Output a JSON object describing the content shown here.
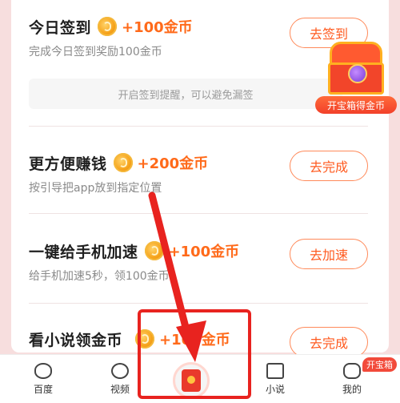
{
  "tasks": [
    {
      "title": "今日签到",
      "reward": "+100金币",
      "desc": "完成今日签到奖励100金币",
      "button": "去签到"
    },
    {
      "title": "更方便赚钱",
      "reward": "+200金币",
      "desc": "按引导把app放到指定位置",
      "button": "去完成"
    },
    {
      "title": "一键给手机加速",
      "reward": "+100金币",
      "desc": "给手机加速5秒，领100金币",
      "button": "去加速"
    },
    {
      "title": "看小说领金币",
      "reward": "+100金币",
      "desc": "",
      "button": "去完成"
    }
  ],
  "reminder": "开启签到提醒，可以避免漏签",
  "treasure": {
    "label": "开宝箱得金币"
  },
  "nav": {
    "items": [
      {
        "label": "百度",
        "icon": "smile-icon"
      },
      {
        "label": "视频",
        "icon": "play-icon"
      },
      {
        "label": "小说",
        "icon": "book-icon"
      },
      {
        "label": "我的",
        "icon": "face-icon"
      }
    ],
    "center_icon": "red-envelope-icon",
    "badge": "开宝箱"
  },
  "colors": {
    "accent": "#ff6a1a",
    "highlight": "#e8231f",
    "background": "#f7dede"
  }
}
